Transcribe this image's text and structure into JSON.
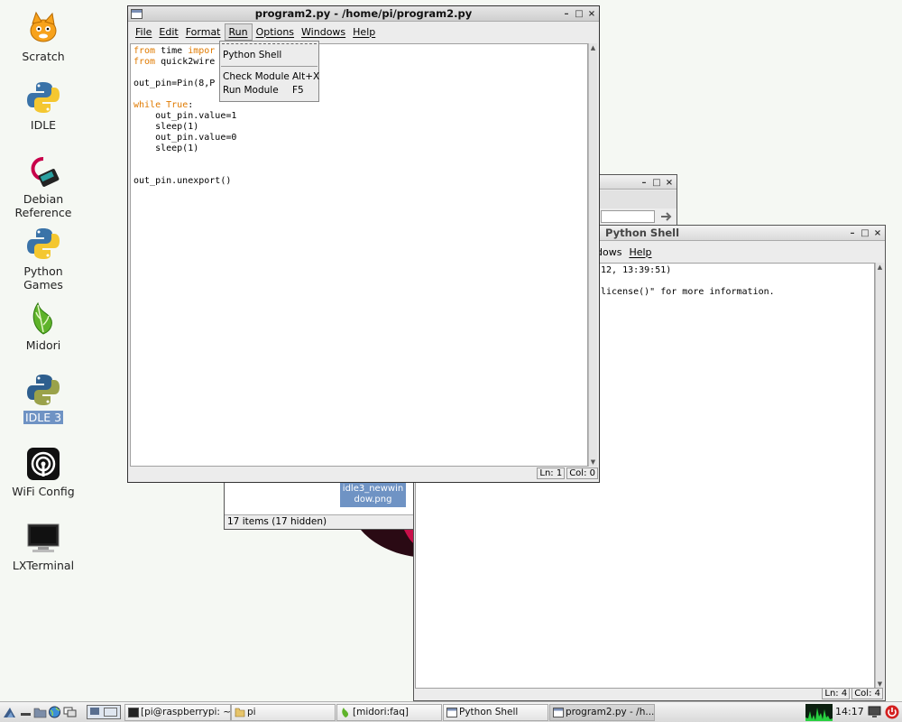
{
  "desktop": {
    "icons": [
      {
        "label": "Scratch",
        "icon": "scratch-cat-icon"
      },
      {
        "label": "IDLE",
        "icon": "python-icon"
      },
      {
        "label": "Debian Reference",
        "icon": "debian-icon"
      },
      {
        "label": "Python Games",
        "icon": "python-icon"
      },
      {
        "label": "Midori",
        "icon": "midori-leaf-icon"
      },
      {
        "label": "IDLE 3",
        "icon": "python-icon",
        "selected": true
      },
      {
        "label": "WiFi Config",
        "icon": "wifi-icon"
      },
      {
        "label": "LXTerminal",
        "icon": "terminal-icon"
      }
    ]
  },
  "editor_window": {
    "title": "program2.py - /home/pi/program2.py",
    "menu": [
      "File",
      "Edit",
      "Format",
      "Run",
      "Options",
      "Windows",
      "Help"
    ],
    "open_menu": "Run",
    "code_lines": [
      [
        {
          "t": "from",
          "k": true
        },
        {
          "t": " time "
        },
        {
          "t": "impor",
          "k": true
        }
      ],
      [
        {
          "t": "from",
          "k": true
        },
        {
          "t": " quick2wire"
        }
      ],
      [],
      [
        {
          "t": "out_pin=Pin(8,P"
        }
      ],
      [],
      [
        {
          "t": "while",
          "k": true
        },
        {
          "t": " "
        },
        {
          "t": "True",
          "k": true
        },
        {
          "t": ":"
        }
      ],
      [
        {
          "t": "    out_pin.value=1"
        }
      ],
      [
        {
          "t": "    sleep(1)"
        }
      ],
      [
        {
          "t": "    out_pin.value=0"
        }
      ],
      [
        {
          "t": "    sleep(1)"
        }
      ],
      [],
      [],
      [
        {
          "t": "out_pin.unexport()"
        }
      ]
    ],
    "status": {
      "line": "Ln: 1",
      "col": "Col: 0"
    }
  },
  "run_menu": {
    "items": [
      {
        "label": "Python Shell",
        "accel": ""
      },
      {
        "label": "Check Module",
        "accel": "Alt+X"
      },
      {
        "label": "Run Module",
        "accel": "F5"
      }
    ]
  },
  "shell_window": {
    "title": "Python Shell",
    "menu_visible": [
      "dows",
      "Help"
    ],
    "lines": [
      "12, 13:39:51)",
      "",
      "license()\" for more information."
    ],
    "status": {
      "line": "Ln: 4",
      "col": "Col: 4"
    }
  },
  "file_manager": {
    "selected_file": "idle3_newwindow.png",
    "status": "17 items (17 hidden)"
  },
  "taskbar": {
    "tasks": [
      {
        "label": "[pi@raspberrypi: ~]",
        "icon": "terminal-icon"
      },
      {
        "label": "pi",
        "icon": "folder-icon"
      },
      {
        "label": "[midori:faq]",
        "icon": "midori-leaf-icon"
      },
      {
        "label": "Python Shell",
        "icon": "window-icon"
      },
      {
        "label": "program2.py - /h...",
        "icon": "window-icon"
      }
    ],
    "clock": "14:17"
  },
  "colors": {
    "keyword": "#e07a00",
    "desktop_bg": "#f5f8f3",
    "selection": "#6f93c4"
  }
}
